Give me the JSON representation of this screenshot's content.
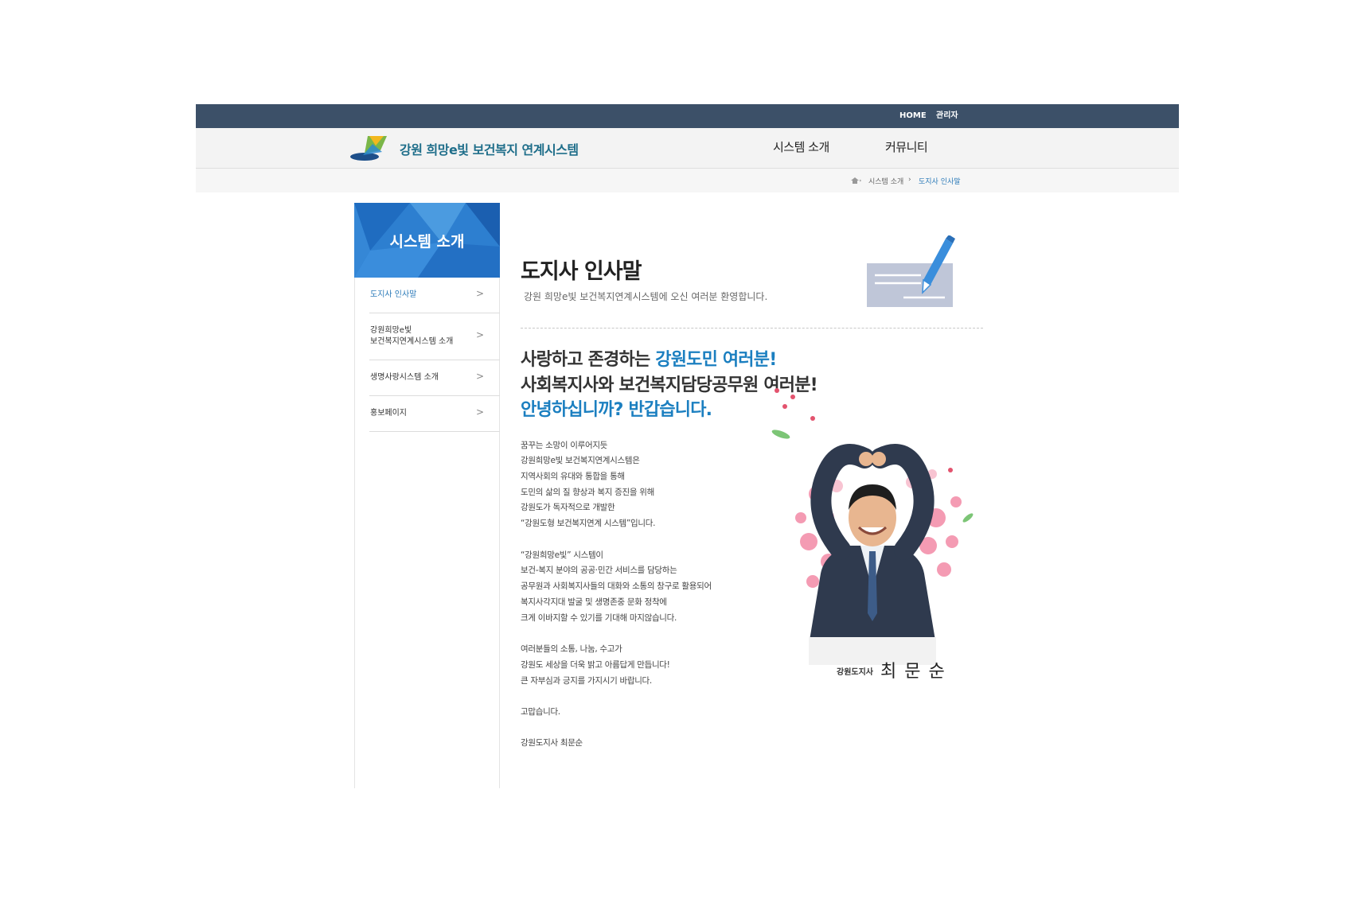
{
  "top_util": {
    "home": "HOME",
    "admin": "관리자"
  },
  "header": {
    "site_name": "강원 희망e빛 보건복지 연계시스템",
    "nav": [
      "시스템 소개",
      "커뮤니티"
    ]
  },
  "breadcrumb": {
    "level1": "시스템 소개",
    "current": "도지사 인사말"
  },
  "sidebar": {
    "banner_title": "시스템 소개",
    "items": [
      {
        "label_lines": [
          "도지사 인사말"
        ],
        "active": true
      },
      {
        "label_lines": [
          "강원희망e빛",
          "보건복지연계시스템 소개"
        ],
        "active": false
      },
      {
        "label_lines": [
          "생명사랑시스템 소개"
        ],
        "active": false
      },
      {
        "label_lines": [
          "홍보페이지"
        ],
        "active": false
      }
    ]
  },
  "content": {
    "title": "도지사 인사말",
    "subtitle": "강원 희망e빛 보건복지연계시스템에 오신 여러분 환영합니다.",
    "headline1_pre": "사랑하고 존경하는 ",
    "headline1_blue": "강원도민 여러분!",
    "headline2": "사회복지사와 보건복지담당공무원 여러분!",
    "headline3": "안녕하십니까? 반갑습니다.",
    "body": [
      "꿈꾸는 소망이 이루어지듯",
      "강원희망e빛 보건복지연계시스템은",
      "지역사회의 유대와 통합을 통해",
      "도민의 삶의 질 향상과 복지 증진을 위해",
      "강원도가 독자적으로 개발한",
      "“강원도형 보건복지연계 시스템”입니다.",
      "",
      "“강원희망e빛” 시스템이",
      "보건-복지 분야의 공공·민간 서비스를 담당하는",
      "공무원과 사회복지사들의 대화와 소통의 창구로 활용되어",
      "복지사각지대 발굴 및 생명존중 문화 정착에",
      "크게 이바지할 수 있기를 기대해 마지않습니다.",
      "",
      "여러분들의 소통, 나눔, 수고가",
      "강원도 세상을 더욱 밝고 아름답게 만듭니다!",
      "큰 자부심과 긍지를 가지시기 바랍니다.",
      "",
      "고맙습니다.",
      "",
      "강원도지사 최문순"
    ],
    "signature_role": "강원도지사",
    "signature_name": "최문순"
  },
  "colors": {
    "topbar": "#3c5068",
    "accent_blue": "#1b7fc0",
    "header_bg": "#f3f3f3"
  },
  "icons": [
    "home-icon",
    "chevron-right-icon",
    "pen-paper-icon",
    "site-logo-icon"
  ]
}
